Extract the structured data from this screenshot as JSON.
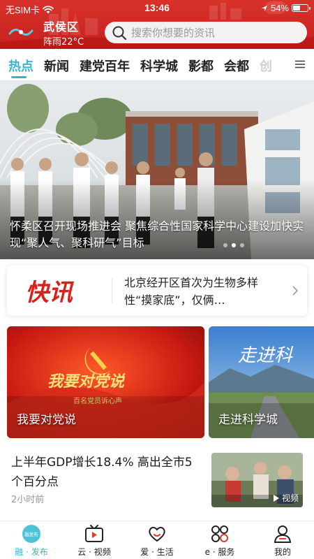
{
  "status_bar": {
    "carrier": "无SIM卡",
    "time": "13:46",
    "battery_text": "54%",
    "battery_level": 0.54
  },
  "header": {
    "location": "武侯区",
    "weather": "阵雨22°C",
    "search_placeholder": "搜索你想要的资讯",
    "accent_color": "#c8211f"
  },
  "tabs": {
    "items": [
      "热点",
      "新闻",
      "建党百年",
      "科学城",
      "影都",
      "会都",
      "创"
    ],
    "active_index": 0,
    "active_color": "#3db1c9"
  },
  "hero": {
    "caption": "怀柔区召开现场推进会 聚焦综合性国家科学中心建设加快实现“聚人气、聚科研气”目标",
    "dot_count": 3,
    "active_dot": 1
  },
  "flash": {
    "logo_text": "快讯",
    "text": "北京经开区首次为生物多样性“摸家底”，仅俩…"
  },
  "cards": [
    {
      "label": "我要对党说",
      "banner_title": "我要对党说",
      "banner_subtitle": "百名党员诉心声"
    },
    {
      "label": "走进科学城",
      "banner_title": "走进科"
    }
  ],
  "news": {
    "title": "上半年GDP增长18.4% 高出全市5个百分点",
    "time": "2小时前",
    "badge": "视频"
  },
  "bottom_nav": {
    "items": [
      {
        "label": "融 · 发布",
        "icon": "home-logo-icon",
        "badge_text": "融发布"
      },
      {
        "label": "云 · 视频",
        "icon": "tv-icon"
      },
      {
        "label": "爱 · 生活",
        "icon": "heart-smile-icon"
      },
      {
        "label": "e · 服务",
        "icon": "grid-icon"
      },
      {
        "label": "我的",
        "icon": "person-icon"
      }
    ],
    "active_index": 0
  }
}
